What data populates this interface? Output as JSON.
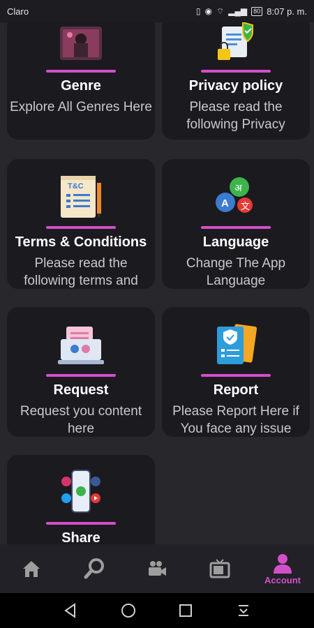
{
  "status_bar": {
    "carrier": "Claro",
    "battery": "80",
    "time": "8:07 p. m."
  },
  "cards": [
    {
      "title": "Genre",
      "description": "Explore All Genres Here",
      "icon": "genre-image-icon"
    },
    {
      "title": "Privacy policy",
      "description": "Please read the following Privacy",
      "icon": "privacy-document-shield-icon"
    },
    {
      "title": "Terms & Conditions",
      "description": "Please read the following terms and",
      "icon": "terms-document-icon"
    },
    {
      "title": "Language",
      "description": "Change The App Language",
      "icon": "language-bubbles-icon"
    },
    {
      "title": "Request",
      "description": "Request you content here",
      "icon": "request-laptop-icon"
    },
    {
      "title": "Report",
      "description": "Please Report Here if You face any issue",
      "icon": "report-clipboard-icon"
    },
    {
      "title": "Share",
      "description": "",
      "icon": "share-social-phone-icon"
    }
  ],
  "nav": {
    "items": [
      {
        "icon": "home-icon"
      },
      {
        "icon": "search-icon"
      },
      {
        "icon": "video-camera-icon"
      },
      {
        "icon": "tv-icon"
      },
      {
        "icon": "account-icon",
        "label": "Account"
      }
    ],
    "active_color": "#d34fc9",
    "inactive_color": "#9e9e9e"
  },
  "colors": {
    "accent": "#d34fc9",
    "background": "#28272c",
    "card": "#1b1a1f"
  }
}
